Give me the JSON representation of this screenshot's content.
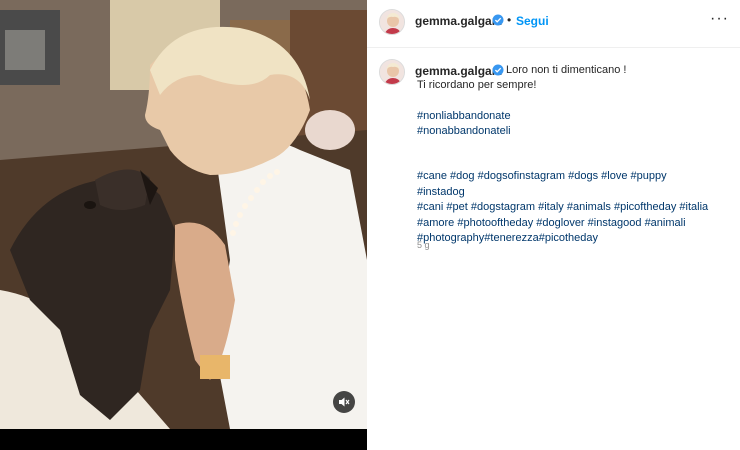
{
  "post": {
    "header": {
      "username": "gemma.galgani",
      "separator": "•",
      "follow_label": "Segui",
      "more_label": "···"
    },
    "caption": {
      "username": "gemma.galgani",
      "line1": "Loro non ti dimenticano !",
      "line2": "Ti ricordano per sempre!",
      "hashtags_top": [
        "#nonliabbandonate",
        "#nonabbandonateli"
      ],
      "hashtags_lines": [
        [
          "#cane",
          "#dog",
          "#dogsofinstagram",
          "#dogs",
          "#love",
          "#puppy",
          "#instadog"
        ],
        [
          "#cani",
          "#pet",
          "#dogstagram",
          "#italy",
          "#animals",
          "#picoftheday",
          "#italia"
        ],
        [
          "#amore",
          "#photooftheday",
          "#doglover",
          "#instagood",
          "#animali"
        ],
        [
          "#photography#tenerezza#picotheday"
        ]
      ]
    },
    "time_ago": "5 g"
  },
  "icons": {
    "verified": "verified-badge-icon",
    "mute": "muted-speaker-icon",
    "more": "more-options-icon"
  },
  "colors": {
    "link_blue": "#0095f6",
    "hashtag": "#00376b",
    "verified": "#3897f0"
  }
}
